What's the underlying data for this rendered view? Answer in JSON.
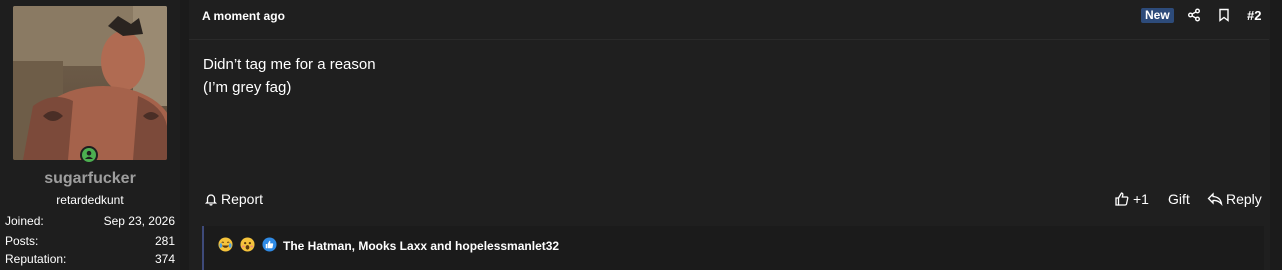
{
  "user": {
    "name": "sugarfucker",
    "title": "retardedkunt",
    "stats": [
      {
        "label": "Joined:",
        "value": "Sep 23, 2026"
      },
      {
        "label": "Posts:",
        "value": "281"
      },
      {
        "label": "Reputation:",
        "value": "374"
      }
    ]
  },
  "post": {
    "time": "A moment ago",
    "badge": "New",
    "number": "#2",
    "lines": [
      "Didn’t tag me for a reason",
      "(I’m grey fag)"
    ]
  },
  "actions": {
    "report": "Report",
    "like_count": "+1",
    "gift": "Gift",
    "reply": "Reply"
  },
  "reactions": {
    "text": "The Hatman, Mooks Laxx and hopelessmanlet32",
    "icons": [
      "laughing-crying-emoji",
      "surprised-emoji",
      "like-reaction-icon"
    ]
  },
  "colors": {
    "background": "#1b1b1b",
    "panel": "#1f1f1f",
    "badge": "#2d4b7a",
    "online": "#4caf50",
    "reaction_border": "#3e4a7a"
  }
}
